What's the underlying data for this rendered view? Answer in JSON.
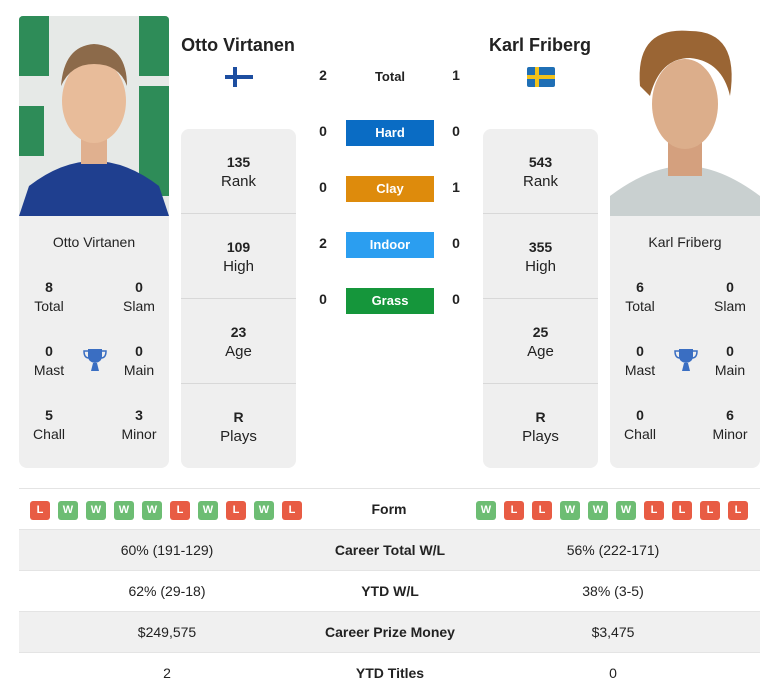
{
  "player1": {
    "name": "Otto Virtanen",
    "country_flag": "finland-flag",
    "rank": "135",
    "rank_label": "Rank",
    "high": "109",
    "high_label": "High",
    "age": "23",
    "age_label": "Age",
    "plays": "R",
    "plays_label": "Plays",
    "titles": {
      "total": "8",
      "total_label": "Total",
      "slam": "0",
      "slam_label": "Slam",
      "mast": "0",
      "mast_label": "Mast",
      "main": "0",
      "main_label": "Main",
      "chall": "5",
      "chall_label": "Chall",
      "minor": "3",
      "minor_label": "Minor"
    },
    "form": [
      "L",
      "W",
      "W",
      "W",
      "W",
      "L",
      "W",
      "L",
      "W",
      "L"
    ]
  },
  "player2": {
    "name": "Karl Friberg",
    "country_flag": "sweden-flag",
    "rank": "543",
    "rank_label": "Rank",
    "high": "355",
    "high_label": "High",
    "age": "25",
    "age_label": "Age",
    "plays": "R",
    "plays_label": "Plays",
    "titles": {
      "total": "6",
      "total_label": "Total",
      "slam": "0",
      "slam_label": "Slam",
      "mast": "0",
      "mast_label": "Mast",
      "main": "0",
      "main_label": "Main",
      "chall": "0",
      "chall_label": "Chall",
      "minor": "6",
      "minor_label": "Minor"
    },
    "form": [
      "W",
      "L",
      "L",
      "W",
      "W",
      "W",
      "L",
      "L",
      "L",
      "L"
    ]
  },
  "h2h": {
    "total_label": "Total",
    "total": {
      "p1": "2",
      "p2": "1"
    },
    "surfaces": [
      {
        "label": "Hard",
        "p1": "0",
        "p2": "0",
        "color": "#0a6cc4"
      },
      {
        "label": "Clay",
        "p1": "0",
        "p2": "1",
        "color": "#de8b0c"
      },
      {
        "label": "Indoor",
        "p1": "2",
        "p2": "0",
        "color": "#2b9ef0"
      },
      {
        "label": "Grass",
        "p1": "0",
        "p2": "0",
        "color": "#15963b"
      }
    ]
  },
  "form_label": "Form",
  "stats": [
    {
      "label": "Career Total W/L",
      "p1": "60% (191-129)",
      "p2": "56% (222-171)"
    },
    {
      "label": "YTD W/L",
      "p1": "62% (29-18)",
      "p2": "38% (3-5)"
    },
    {
      "label": "Career Prize Money",
      "p1": "$249,575",
      "p2": "$3,475"
    },
    {
      "label": "YTD Titles",
      "p1": "2",
      "p2": "0"
    }
  ]
}
